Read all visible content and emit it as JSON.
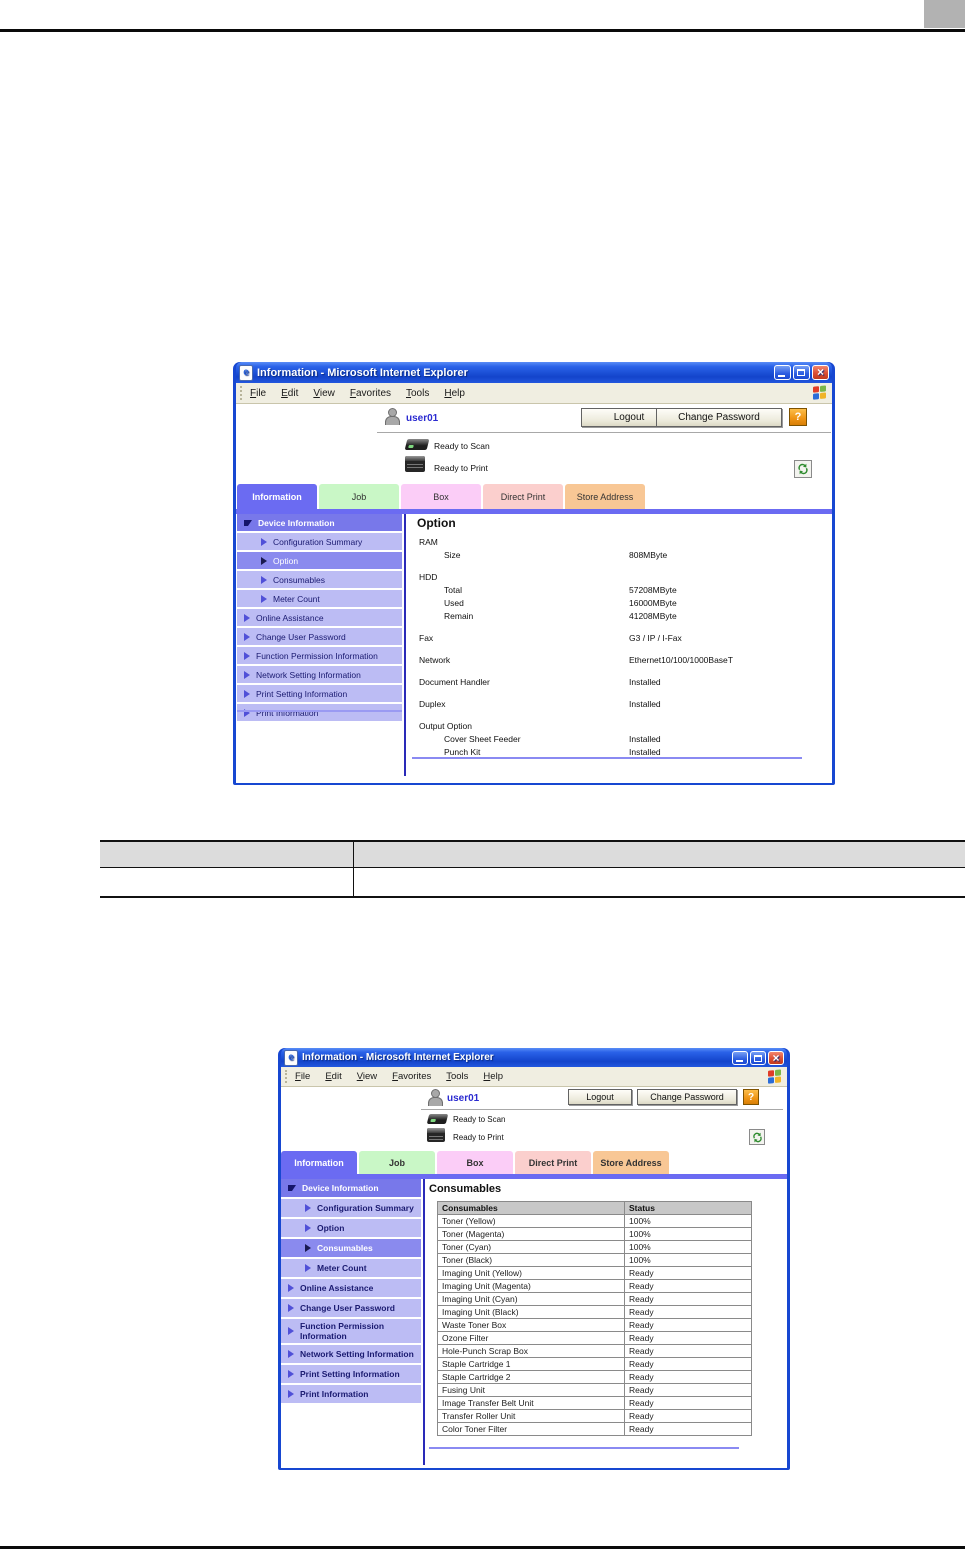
{
  "browser": {
    "window_title": "Information - Microsoft Internet Explorer",
    "menu_items": [
      "File",
      "Edit",
      "View",
      "Favorites",
      "Tools",
      "Help"
    ],
    "user_name": "user01",
    "logout_label": "Logout",
    "change_password_label": "Change Password",
    "help_label": "?",
    "status": {
      "scan": "Ready to Scan",
      "print": "Ready to Print"
    },
    "tabs": [
      {
        "label": "Information",
        "color": "#6b6bf2",
        "selected": true
      },
      {
        "label": "Job",
        "color": "#c9f7c6",
        "selected": false
      },
      {
        "label": "Box",
        "color": "#fbcdf7",
        "selected": false
      },
      {
        "label": "Direct Print",
        "color": "#fbcfcd",
        "selected": false
      },
      {
        "label": "Store Address",
        "color": "#f8c795",
        "selected": false
      }
    ]
  },
  "sidebar": {
    "root": "Device Information",
    "sub_items": [
      "Configuration Summary",
      "Option",
      "Consumables",
      "Meter Count"
    ],
    "items": [
      "Online Assistance",
      "Change User Password",
      "Function Permission Information",
      "Network Setting Information",
      "Print Setting Information",
      "Print Information"
    ]
  },
  "window1": {
    "selected_menu": "Option",
    "heading": "Option",
    "sections": [
      {
        "label": "RAM",
        "children": [
          {
            "label": "Size",
            "value": "808MByte"
          }
        ]
      },
      {
        "label": "HDD",
        "children": [
          {
            "label": "Total",
            "value": "57208MByte"
          },
          {
            "label": "Used",
            "value": "16000MByte"
          },
          {
            "label": "Remain",
            "value": "41208MByte"
          }
        ]
      },
      {
        "label": "Fax",
        "value": "G3 / IP / I-Fax"
      },
      {
        "label": "Network",
        "value": "Ethernet10/100/1000BaseT"
      },
      {
        "label": "Document Handler",
        "value": "Installed"
      },
      {
        "label": "Duplex",
        "value": "Installed"
      },
      {
        "label": "Output Option",
        "children": [
          {
            "label": "Cover Sheet Feeder",
            "value": "Installed"
          },
          {
            "label": "Punch Kit",
            "value": "Installed"
          }
        ]
      }
    ]
  },
  "window2": {
    "selected_menu": "Consumables",
    "heading": "Consumables",
    "table": {
      "headers": [
        "Consumables",
        "Status"
      ],
      "rows": [
        [
          "Toner (Yellow)",
          "100%"
        ],
        [
          "Toner (Magenta)",
          "100%"
        ],
        [
          "Toner (Cyan)",
          "100%"
        ],
        [
          "Toner (Black)",
          "100%"
        ],
        [
          "Imaging Unit (Yellow)",
          "Ready"
        ],
        [
          "Imaging Unit (Magenta)",
          "Ready"
        ],
        [
          "Imaging Unit (Cyan)",
          "Ready"
        ],
        [
          "Imaging Unit (Black)",
          "Ready"
        ],
        [
          "Waste Toner Box",
          "Ready"
        ],
        [
          "Ozone Filter",
          "Ready"
        ],
        [
          "Hole-Punch Scrap Box",
          "Ready"
        ],
        [
          "Staple Cartridge 1",
          "Ready"
        ],
        [
          "Staple Cartridge 2",
          "Ready"
        ],
        [
          "Fusing Unit",
          "Ready"
        ],
        [
          "Image Transfer Belt Unit",
          "Ready"
        ],
        [
          "Transfer Roller Unit",
          "Ready"
        ],
        [
          "Color Toner Filter",
          "Ready"
        ]
      ]
    }
  },
  "reference_table": {
    "header_cells": [
      "",
      ""
    ],
    "body_cells": [
      "",
      ""
    ]
  },
  "colors": {
    "accent_periwinkle": "#6b6bf2",
    "xp_title_blue": "#1747d1",
    "sidebar_item": "#bcbcf4",
    "sidebar_selected": "#8a8aee",
    "table_header_gray": "#c8c8c8",
    "page_rule_black": "#0a0a0a",
    "corner_tab_gray": "#b2b2b2"
  }
}
